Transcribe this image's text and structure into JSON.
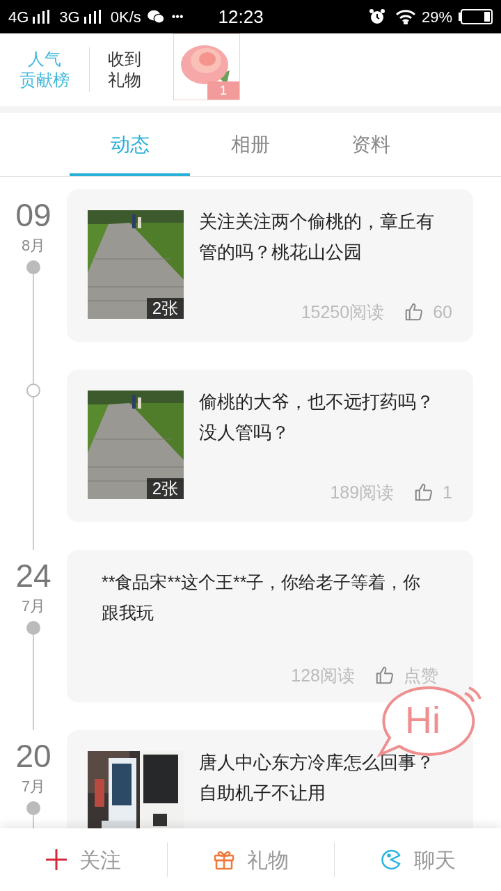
{
  "status_bar": {
    "network_1": "4G",
    "network_2": "3G",
    "speed": "0K/s",
    "more": "•••",
    "time": "12:23",
    "battery": "29%"
  },
  "header": {
    "ranking_link": [
      "人气",
      "贡献榜"
    ],
    "gifts_label": [
      "收到",
      "礼物"
    ],
    "gift_count": "1"
  },
  "tabs": [
    {
      "label": "动态",
      "selected": true
    },
    {
      "label": "相册",
      "selected": false
    },
    {
      "label": "资料",
      "selected": false
    }
  ],
  "posts": [
    {
      "day": "09",
      "month": "8月",
      "photo_count": "2张",
      "text": "关注关注两个偷桃的，章丘有管的吗？桃花山公园",
      "reads": "15250阅读",
      "likes": "60"
    },
    {
      "photo_count": "2张",
      "text": "偷桃的大爷，也不远打药吗？没人管吗？",
      "reads": "189阅读",
      "likes": "1"
    },
    {
      "day": "24",
      "month": "7月",
      "kind": "text",
      "text": "**食品宋**这个王**子，你给老子等着，你跟我玩",
      "reads": "128阅读",
      "likes": "点赞"
    },
    {
      "day": "20",
      "month": "7月",
      "text": "唐人中心东方冷库怎么回事？自助机子不让用"
    }
  ],
  "hi_bubble": "Hi",
  "bottom_bar": [
    {
      "kind": "follow",
      "label": "关注"
    },
    {
      "kind": "gift",
      "label": "礼物"
    },
    {
      "kind": "chat",
      "label": "聊天"
    }
  ]
}
